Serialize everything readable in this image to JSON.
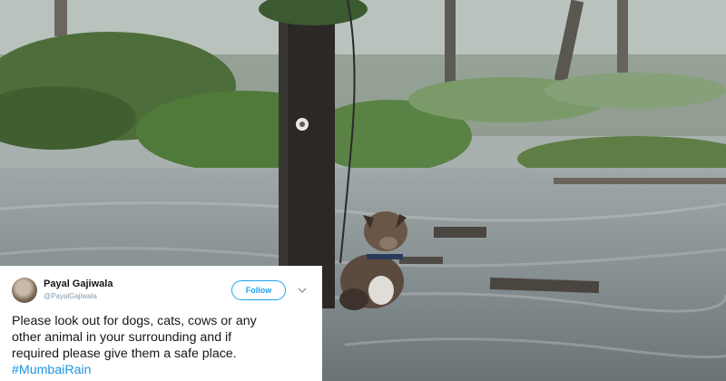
{
  "tweet": {
    "display_name": "Payal Gajiwala",
    "handle": "@PayalGajiwala",
    "follow_label": "Follow",
    "text": "Please look out for dogs, cats, cows or any\nother animal in your surrounding and if\nrequired please give them a safe place.",
    "hashtag": "#MumbaiRain"
  },
  "colors": {
    "link_blue": "#1da1f2",
    "hashtag_blue": "#1b95e0",
    "floodwater": "#8e989a",
    "vegetation": "#4f7a3a"
  },
  "icons": {
    "more": "chevron-down-icon",
    "avatar": "avatar"
  }
}
